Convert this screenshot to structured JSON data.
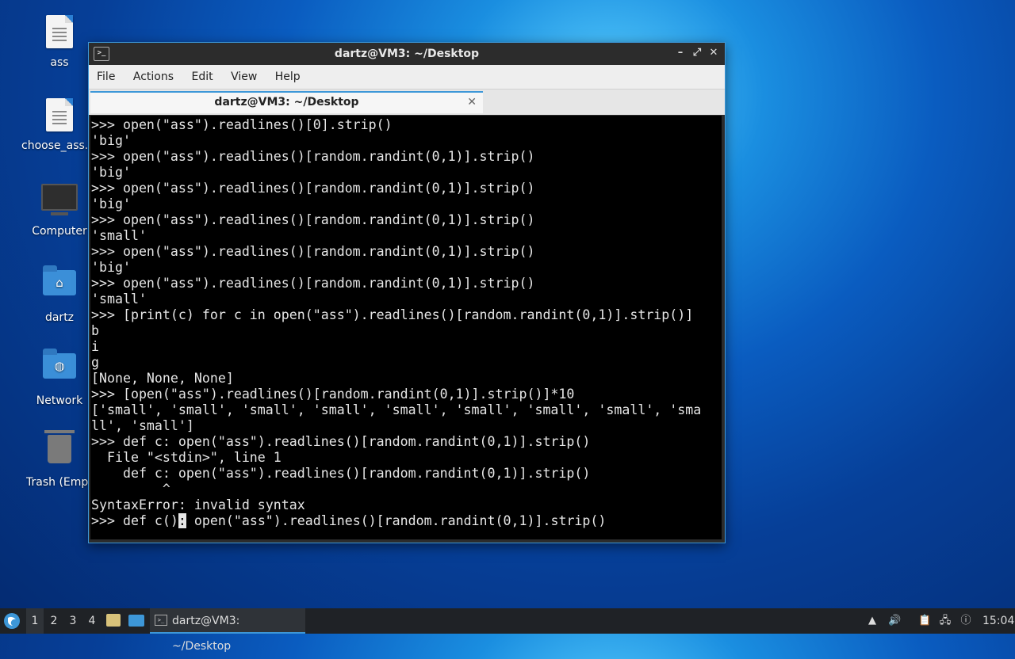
{
  "desktop": {
    "icons": [
      {
        "label": "ass"
      },
      {
        "label": "choose_ass.py"
      },
      {
        "label": "Computer"
      },
      {
        "label": "dartz"
      },
      {
        "label": "Network"
      },
      {
        "label": "Trash (Empty)"
      }
    ]
  },
  "window": {
    "title": "dartz@VM3: ~/Desktop",
    "controls": {
      "minimize": "–",
      "maximize": "⤢",
      "close": "✕"
    },
    "menu": [
      "File",
      "Actions",
      "Edit",
      "View",
      "Help"
    ],
    "tab": {
      "label": "dartz@VM3: ~/Desktop",
      "close": "✕"
    },
    "terminal": {
      "lines": [
        ">>> open(\"ass\").readlines()[0].strip()",
        "'big'",
        ">>> open(\"ass\").readlines()[random.randint(0,1)].strip()",
        "'big'",
        ">>> open(\"ass\").readlines()[random.randint(0,1)].strip()",
        "'big'",
        ">>> open(\"ass\").readlines()[random.randint(0,1)].strip()",
        "'small'",
        ">>> open(\"ass\").readlines()[random.randint(0,1)].strip()",
        "'big'",
        ">>> open(\"ass\").readlines()[random.randint(0,1)].strip()",
        "'small'",
        ">>> [print(c) for c in open(\"ass\").readlines()[random.randint(0,1)].strip()]",
        "b",
        "i",
        "g",
        "[None, None, None]",
        ">>> [open(\"ass\").readlines()[random.randint(0,1)].strip()]*10",
        "['small', 'small', 'small', 'small', 'small', 'small', 'small', 'small', 'sma",
        "ll', 'small']",
        ">>> def c: open(\"ass\").readlines()[random.randint(0,1)].strip()",
        "  File \"<stdin>\", line 1",
        "    def c: open(\"ass\").readlines()[random.randint(0,1)].strip()",
        "         ^",
        "SyntaxError: invalid syntax"
      ],
      "current_prefix": ">>> def c()",
      "cursor_char": ":",
      "current_suffix": " open(\"ass\").readlines()[random.randint(0,1)].strip()"
    }
  },
  "taskbar": {
    "workspaces": [
      "1",
      "2",
      "3",
      "4"
    ],
    "task_label": "dartz@VM3: ~/Desktop",
    "clock": "15:04"
  }
}
